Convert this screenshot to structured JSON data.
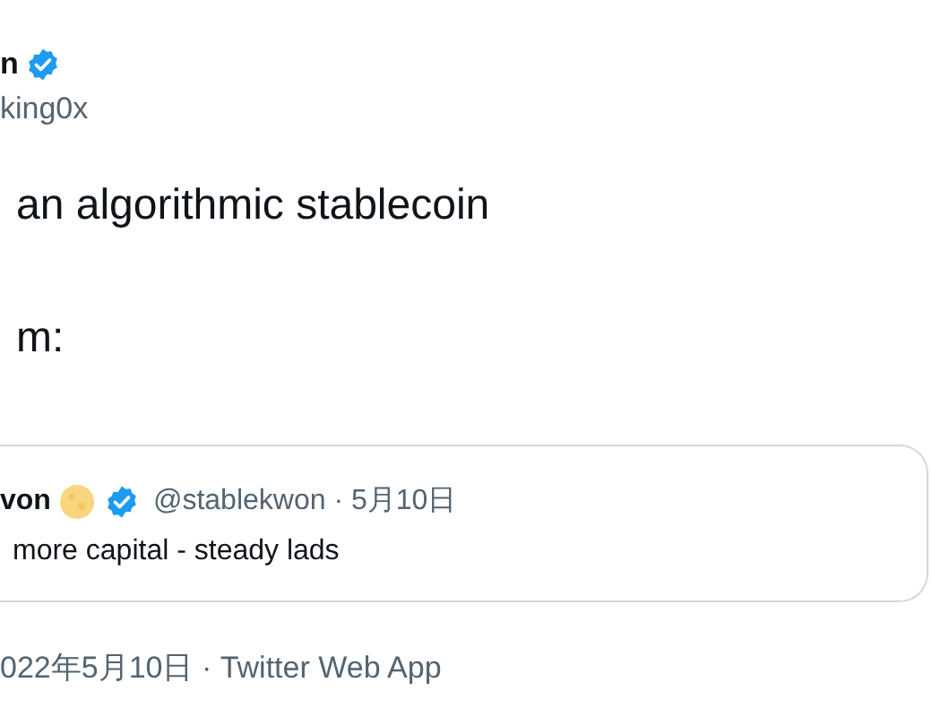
{
  "author": {
    "name": "n",
    "verified": true,
    "handle": "king0x"
  },
  "tweet_lines": [
    "an algorithmic stablecoin",
    "m:"
  ],
  "quote": {
    "name": "von",
    "verified": true,
    "handle": "@stablekwon · 5月10日",
    "text": "more capital - steady lads"
  },
  "footer": "022年5月10日 · Twitter Web App"
}
